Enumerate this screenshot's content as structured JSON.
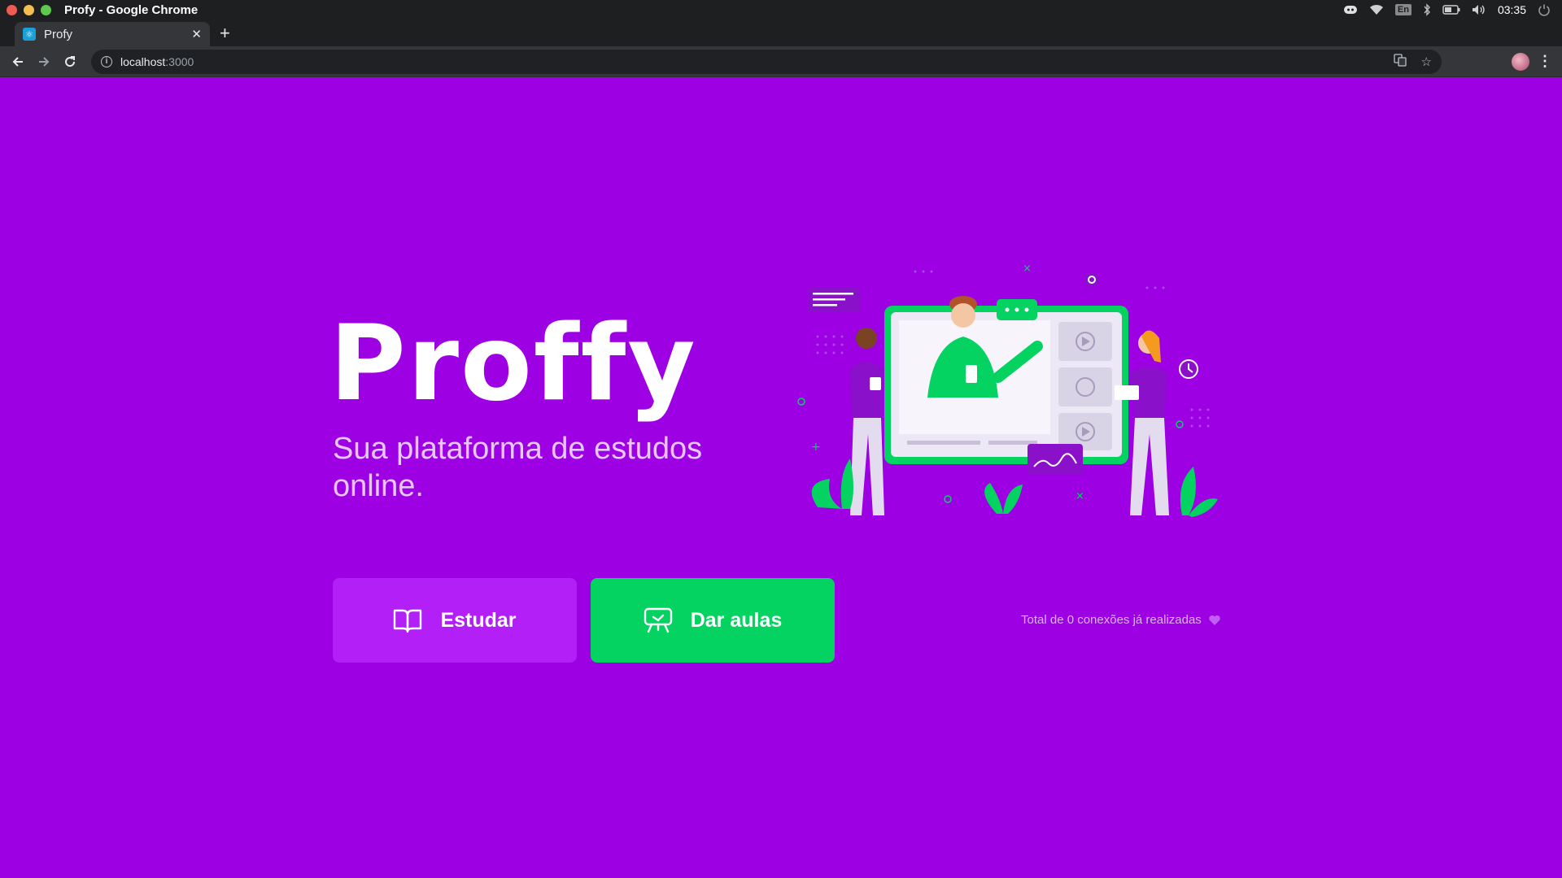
{
  "os": {
    "window_title": "Profy - Google Chrome",
    "input_language": "En",
    "clock": "03:35",
    "tray_icons": [
      "discord-icon",
      "wifi-icon",
      "keyboard-language-icon",
      "bluetooth-icon",
      "battery-icon",
      "volume-icon",
      "clock-text",
      "power-icon"
    ]
  },
  "browser": {
    "tab": {
      "title": "Profy",
      "favicon": "react-icon"
    },
    "url_host": "localhost",
    "url_port": ":3000",
    "toolbar_icons": [
      "back-icon",
      "forward-icon",
      "reload-icon",
      "info-icon",
      "translate-icon",
      "star-icon",
      "profile-avatar",
      "menu-icon"
    ]
  },
  "page": {
    "logo": "Proffy",
    "tagline": "Sua plataforma de estudos online.",
    "buttons": {
      "study": {
        "label": "Estudar",
        "icon": "book-icon"
      },
      "teach": {
        "label": "Dar aulas",
        "icon": "presentation-board-icon"
      }
    },
    "connections_text": "Total de 0 conexões já realizadas",
    "connections_icon": "heart-icon"
  },
  "colors": {
    "background": "#9c00e3",
    "study_button": "#b31ff7",
    "teach_button": "#04d361",
    "tagline": "#e6c7f7",
    "accent_green": "#04d361"
  }
}
